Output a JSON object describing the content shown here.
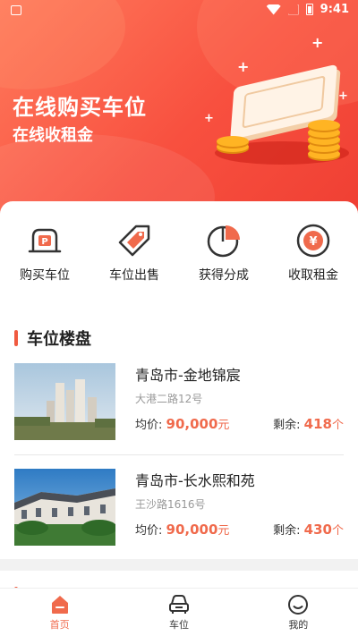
{
  "status_bar": {
    "time": "9:41",
    "icons": [
      "image-icon",
      "wifi-icon",
      "signal-icon",
      "battery-icon"
    ]
  },
  "hero": {
    "title": "在线购买车位",
    "subtitle": "在线收租金",
    "colors": {
      "start": "#ff7a5c",
      "end": "#ef3f33"
    }
  },
  "quick_actions": [
    {
      "label": "购买车位",
      "icon": "parking-car-icon"
    },
    {
      "label": "车位出售",
      "icon": "price-tag-icon"
    },
    {
      "label": "获得分成",
      "icon": "pie-chart-icon"
    },
    {
      "label": "收取租金",
      "icon": "yen-coin-icon"
    }
  ],
  "section": {
    "title": "车位楼盘"
  },
  "listings": [
    {
      "name": "青岛市-金地锦宸",
      "address": "大港二路12号",
      "price_label": "均价:",
      "price": "90,000",
      "price_unit": "元",
      "remain_label": "剩余:",
      "remain": "418",
      "remain_unit": "个"
    },
    {
      "name": "青岛市-长水熙和苑",
      "address": "王沙路1616号",
      "price_label": "均价:",
      "price": "90,000",
      "price_unit": "元",
      "remain_label": "剩余:",
      "remain": "430",
      "remain_unit": "个"
    }
  ],
  "tabbar": [
    {
      "label": "首页",
      "icon": "home-icon",
      "active": true
    },
    {
      "label": "车位",
      "icon": "car-icon",
      "active": false
    },
    {
      "label": "我的",
      "icon": "profile-icon",
      "active": false
    }
  ],
  "accent_color": "#f06a4c"
}
